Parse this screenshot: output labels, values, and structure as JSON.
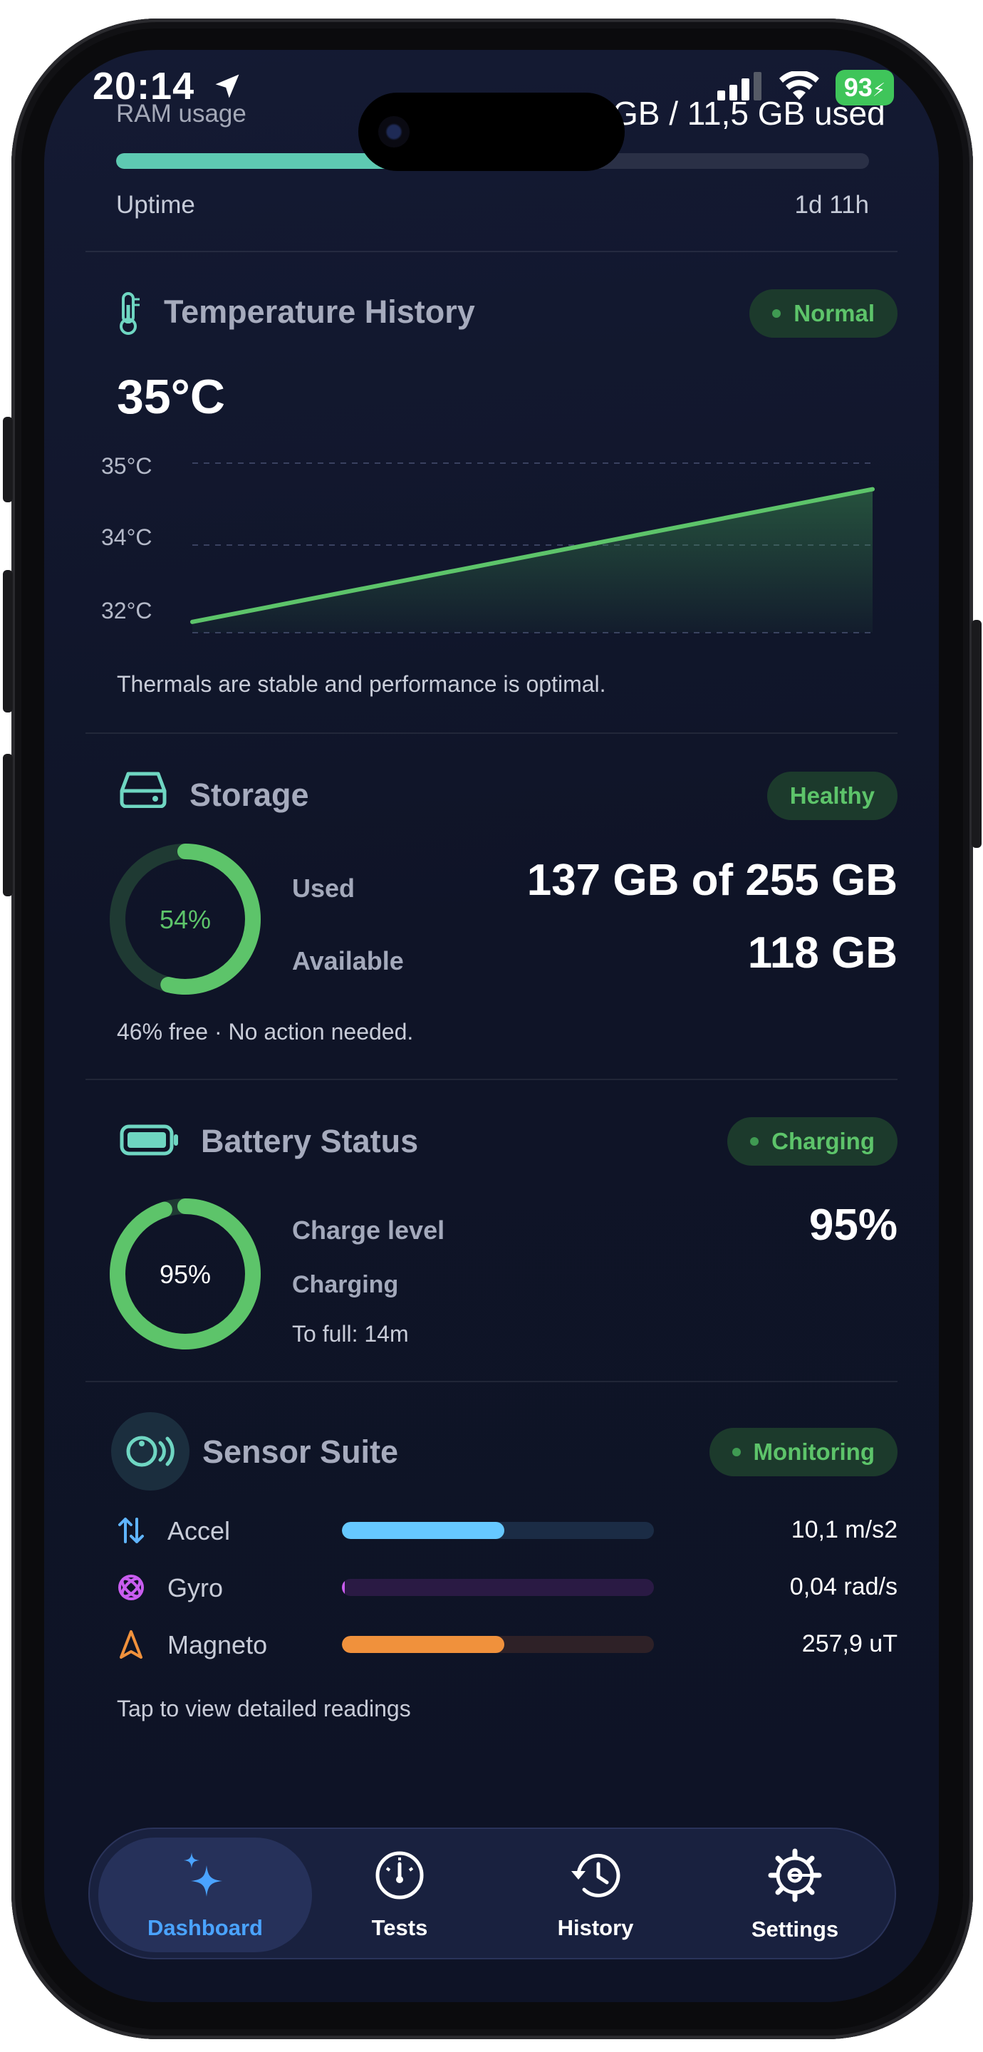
{
  "status_bar": {
    "time": "20:14",
    "battery": "93"
  },
  "system": {
    "ram_label": "RAM usage",
    "ram_used_text": "GB / 11,5 GB used",
    "ram_fraction": 0.38,
    "uptime_label": "Uptime",
    "uptime_value": "1d 11h"
  },
  "temperature": {
    "title": "Temperature History",
    "badge": "Normal",
    "current": "35°C",
    "y_ticks": [
      "35°C",
      "34°C",
      "32°C"
    ],
    "note": "Thermals are stable and performance is optimal."
  },
  "chart_data": {
    "type": "area",
    "title": "Temperature History",
    "ylabel": "",
    "xlabel": "",
    "y_ticks": [
      "35°C",
      "34°C",
      "32°C"
    ],
    "series": [
      {
        "values": [
          32,
          35
        ]
      }
    ],
    "color": "#5dc46a",
    "grid": true
  },
  "storage": {
    "title": "Storage",
    "badge": "Healthy",
    "percent": 54,
    "percent_text": "54%",
    "used_label": "Used",
    "used_value": "137 GB of 255 GB",
    "available_label": "Available",
    "available_value": "118 GB",
    "note": "46% free · No action needed."
  },
  "battery": {
    "title": "Battery Status",
    "badge": "Charging",
    "percent": 95,
    "percent_text": "95%",
    "charge_label": "Charge level",
    "charge_value": "95%",
    "state_label": "Charging",
    "to_full": "To full: 14m"
  },
  "sensors": {
    "title": "Sensor Suite",
    "badge": "Monitoring",
    "rows": [
      {
        "name": "Accel",
        "value": "10,1 m/s2",
        "fraction": 0.52,
        "color": "#66c8ff",
        "track": "#1b2c45",
        "icon": "arrows-up-down-icon"
      },
      {
        "name": "Gyro",
        "value": "0,04 rad/s",
        "fraction": 0.01,
        "color": "#c95df0",
        "track": "#2a1a44",
        "icon": "gyroscope-icon"
      },
      {
        "name": "Magneto",
        "value": "257,9 uT",
        "fraction": 0.52,
        "color": "#f0913c",
        "track": "#2e2127",
        "icon": "compass-needle-icon"
      }
    ],
    "note": "Tap to view detailed readings"
  },
  "nav": {
    "items": [
      {
        "label": "Dashboard",
        "icon": "sparkles-icon",
        "active": true
      },
      {
        "label": "Tests",
        "icon": "gauge-icon",
        "active": false
      },
      {
        "label": "History",
        "icon": "history-clock-icon",
        "active": false
      },
      {
        "label": "Settings",
        "icon": "gear-icon",
        "active": false
      }
    ]
  },
  "colors": {
    "accent_green": "#5dc46a",
    "accent_teal": "#5ecab2",
    "accent_blue": "#4aa3ff",
    "background": "#10162b"
  }
}
